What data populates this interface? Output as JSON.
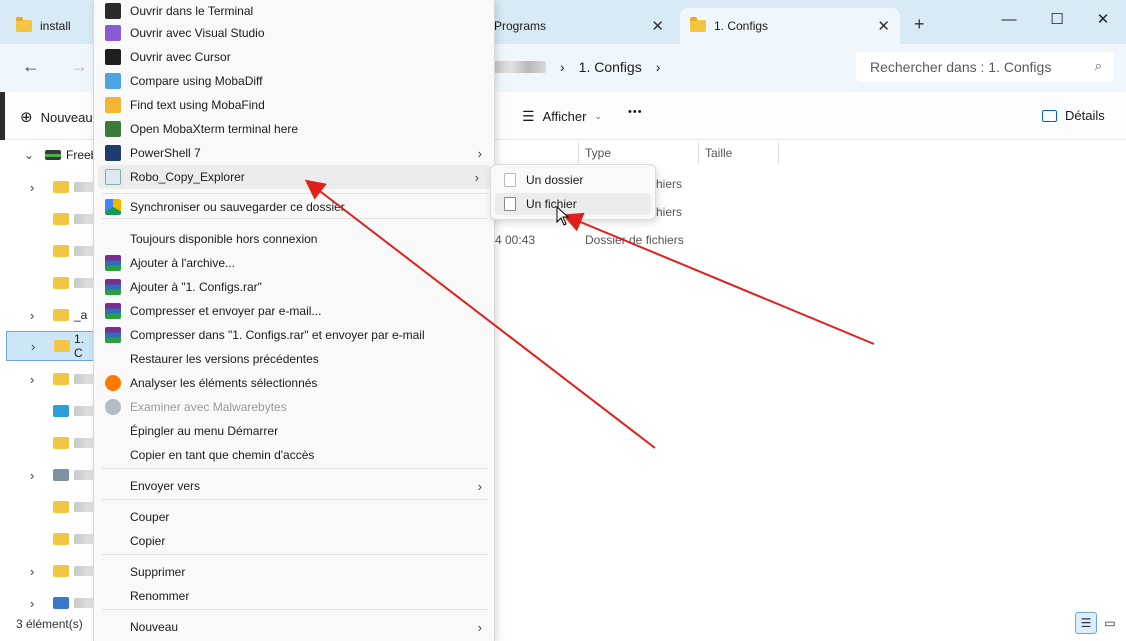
{
  "tabs": [
    {
      "label": "install"
    },
    {
      "label": "Programs"
    },
    {
      "label": "1. Configs"
    }
  ],
  "window": {
    "minimize": "—",
    "maximize": "☐",
    "close": "✕",
    "new_tab": "+"
  },
  "nav": {
    "back": "←",
    "forward": "→"
  },
  "breadcrumb": {
    "current": "1. Configs",
    "sep": "›"
  },
  "search": {
    "placeholder": "Rechercher dans : 1. Configs"
  },
  "toolbar": {
    "new_label": "Nouveau",
    "view_label": "Afficher",
    "more": "•••",
    "details_label": "Détails"
  },
  "sidebar": {
    "root_label": "Freeb",
    "items": [
      {
        "label": ""
      },
      {
        "label": ""
      },
      {
        "label": ""
      },
      {
        "label": ""
      },
      {
        "label": "_a"
      },
      {
        "label": "1. C"
      },
      {
        "label": ""
      },
      {
        "label": ""
      },
      {
        "label": ""
      },
      {
        "label": ""
      },
      {
        "label": ""
      },
      {
        "label": ""
      },
      {
        "label": ""
      },
      {
        "label": ""
      }
    ]
  },
  "columns": {
    "type": "Type",
    "size": "Taille"
  },
  "files": [
    {
      "date": "",
      "type": "hiers"
    },
    {
      "date": "",
      "type": "hiers"
    },
    {
      "date": "4 00:43",
      "type": "Dossier de fichiers"
    }
  ],
  "status": {
    "count": "3 élément(s)"
  },
  "context_menu": {
    "items": [
      {
        "label": "Ouvrir dans le Terminal",
        "icon": "terminal-icon"
      },
      {
        "label": "Ouvrir avec Visual Studio",
        "icon": "visual-studio-icon"
      },
      {
        "label": "Ouvrir avec Cursor",
        "icon": "cursor-app-icon"
      },
      {
        "label": "Compare using MobaDiff",
        "icon": "mobadiff-icon"
      },
      {
        "label": "Find text using MobaFind",
        "icon": "mobafind-icon"
      },
      {
        "label": "Open MobaXterm terminal here",
        "icon": "mobaxterm-icon"
      },
      {
        "label": "PowerShell 7",
        "icon": "powershell-icon"
      },
      {
        "label": "Robo_Copy_Explorer",
        "icon": "robocopy-icon"
      },
      {
        "label": "Synchroniser ou sauvegarder ce dossier",
        "icon": "google-drive-icon"
      },
      {
        "label": "Toujours disponible hors connexion"
      },
      {
        "label": "Ajouter à l'archive...",
        "icon": "winrar-icon"
      },
      {
        "label": "Ajouter à \"1. Configs.rar\"",
        "icon": "winrar-icon"
      },
      {
        "label": "Compresser et envoyer par e-mail...",
        "icon": "winrar-icon"
      },
      {
        "label": "Compresser dans \"1. Configs.rar\" et envoyer par e-mail",
        "icon": "winrar-icon"
      },
      {
        "label": "Restaurer les versions précédentes"
      },
      {
        "label": "Analyser les éléments sélectionnés",
        "icon": "avast-icon"
      },
      {
        "label": "Examiner avec Malwarebytes",
        "icon": "malwarebytes-icon"
      },
      {
        "label": "Épingler au menu Démarrer"
      },
      {
        "label": "Copier en tant que chemin d'accès"
      },
      {
        "label": "Envoyer vers"
      },
      {
        "label": "Couper"
      },
      {
        "label": "Copier"
      },
      {
        "label": "Supprimer"
      },
      {
        "label": "Renommer"
      },
      {
        "label": "Nouveau"
      }
    ],
    "submenu_arrow": "›"
  },
  "submenu": {
    "items": [
      {
        "label": "Un dossier"
      },
      {
        "label": "Un fichier"
      }
    ]
  },
  "colors": {
    "accent": "#0067c0",
    "arrow_red": "#e0201c",
    "tabbar": "#d7eaf6",
    "menu_bg": "#f9f9f9"
  }
}
